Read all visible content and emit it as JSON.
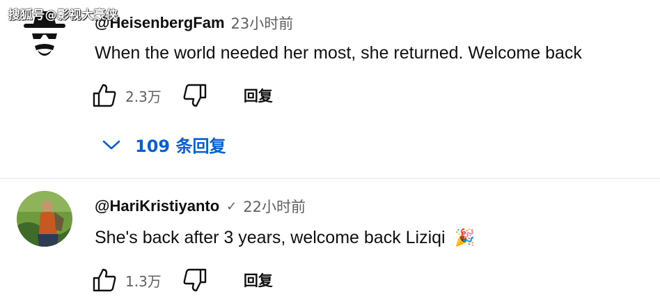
{
  "watermark": "搜狐号@影视大豪侠",
  "comments": [
    {
      "author": "@HeisenbergFam",
      "time": "23小时前",
      "text": "When the world needed her most, she returned. Welcome back",
      "likes": "2.3万",
      "reply_label": "回复",
      "replies_label": "109 条回复",
      "avatar_icon": "spy-incognito-icon"
    },
    {
      "author": "@HariKristiyanto",
      "verified": "✓",
      "time": "22小时前",
      "text": "She's back after 3 years, welcome back Liziqi",
      "emoji": "🎉",
      "likes": "1.3万",
      "reply_label": "回复",
      "avatar_icon": "profile-photo"
    }
  ],
  "colors": {
    "link": "#065fd4",
    "secondary": "#606060",
    "primary": "#0f0f0f"
  }
}
